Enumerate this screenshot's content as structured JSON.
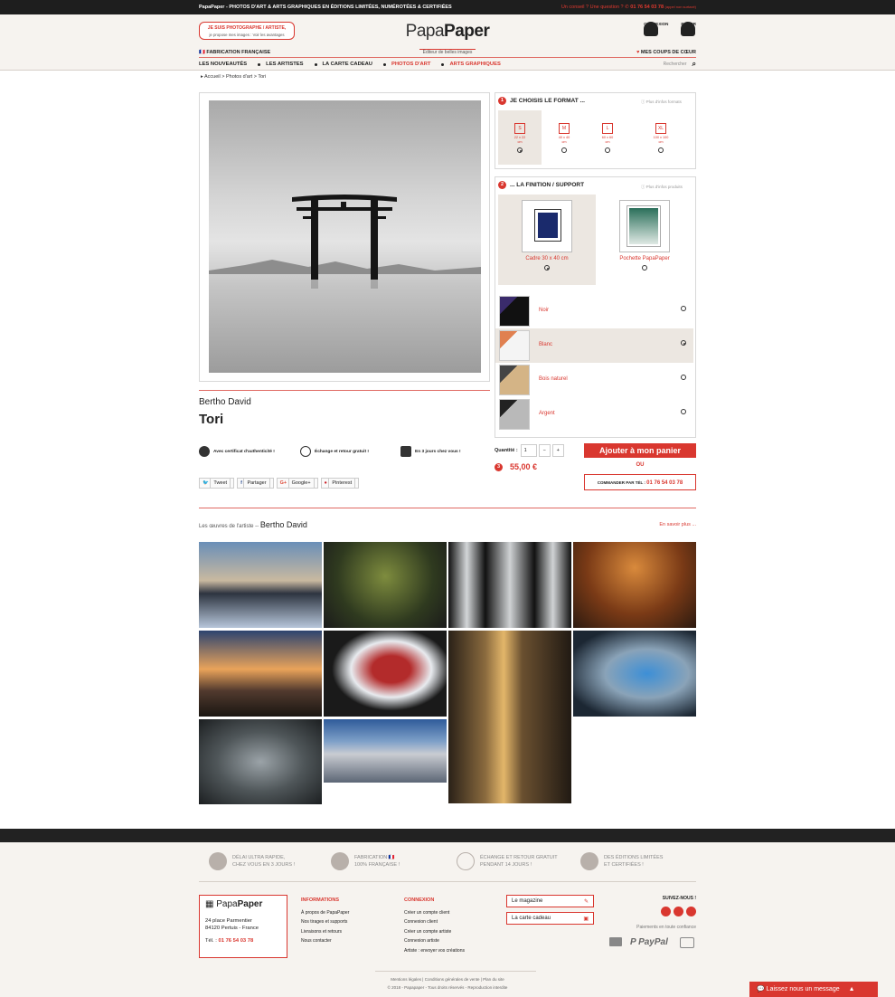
{
  "topbar": {
    "brand_small": "PapaPaper",
    "tagline": "- PHOTOS D'ART & ARTS GRAPHIQUES EN ÉDITIONS LIMITÉES, NUMÉROTÉES & CERTIFIÉES",
    "conseil": "Un conseil ? Une question ?",
    "phone": "01 76 54 03 78",
    "phone_note": "(appel non surtaxé)"
  },
  "header": {
    "photographer_btn": "JE SUIS PHOTOGRAPHE / ARTISTE,",
    "photographer_sub": "je propose mes images : Voir les avantages",
    "logo_light": "Papa",
    "logo_bold": "Paper",
    "logo_sub": "Éditeur de belles images",
    "connexion": "CONNEXION",
    "panier": "PANIER",
    "fabrication": "FABRICATION FRANÇAISE",
    "coups_coeur": "MES COUPS DE CŒUR",
    "search_placeholder": "Rechercher"
  },
  "nav": [
    "LES NOUVEAUTÉS",
    "LES ARTISTES",
    "LA CARTE CADEAU",
    "PHOTOS D'ART",
    "ARTS GRAPHIQUES"
  ],
  "breadcrumb": "Accueil > Photos d'art > Tori",
  "product": {
    "artist": "Bertho David",
    "title": "Tori",
    "features": [
      "Avec certificat d'authenticité !",
      "Échange et retour gratuit !",
      "En 3 jours chez vous !"
    ],
    "share": [
      "Tweet",
      "Partager",
      "Google+",
      "Pinterest"
    ]
  },
  "step1": {
    "num": "1",
    "title": "JE CHOISIS LE FORMAT ...",
    "info": "Plus d'infos formats",
    "formats": [
      {
        "size": "S",
        "dim": "22 x 22",
        "unit": "cm",
        "selected": true
      },
      {
        "size": "M",
        "dim": "40 x 40",
        "unit": "cm",
        "selected": false
      },
      {
        "size": "L",
        "dim": "60 x 60",
        "unit": "cm",
        "selected": false
      },
      {
        "size": "XL",
        "dim": "100 x 100",
        "unit": "cm",
        "selected": false
      }
    ]
  },
  "step2": {
    "num": "2",
    "title": "... LA FINITION / SUPPORT",
    "info": "Plus d'infos produits",
    "finishes": [
      {
        "label": "Cadre 30 x 40 cm",
        "selected": true
      },
      {
        "label": "Pochette PapaPaper",
        "selected": false
      }
    ],
    "frames": [
      {
        "label": "Noir",
        "selected": false
      },
      {
        "label": "Blanc",
        "selected": true
      },
      {
        "label": "Bois naturel",
        "selected": false
      },
      {
        "label": "Argent",
        "selected": false
      }
    ]
  },
  "purchase": {
    "qty_label": "Quantité :",
    "qty_value": "1",
    "minus": "−",
    "plus": "+",
    "step_num": "3",
    "price": "55,00 €",
    "add_to_cart": "Ajouter à mon panier",
    "ou": "OU",
    "phone_order": "COMMANDER PAR TÉL :",
    "phone": "01 76 54 03 78"
  },
  "artist_works": {
    "label": "Les œuvres de l'artiste --",
    "artist": "Bertho David",
    "more": "En savoir plus ..."
  },
  "footer": {
    "reassurance": [
      {
        "l1": "DÉLAI ULTRA RAPIDE,",
        "l2": "CHEZ VOUS EN 3 JOURS !"
      },
      {
        "l1": "FABRICATION 🇫🇷",
        "l2": "100% FRANÇAISE !"
      },
      {
        "l1": "ÉCHANGE ET RETOUR GRATUIT",
        "l2": "PENDANT 14 JOURS !"
      },
      {
        "l1": "DES ÉDITIONS LIMITÉES",
        "l2": "ET CERTIFIÉES !"
      }
    ],
    "address": {
      "logo_light": "Papa",
      "logo_bold": "Paper",
      "line1": "24 place Parmentier",
      "line2": "84120 Pertuis - France",
      "tel_label": "Tél. :",
      "tel": "01 76 54 03 78"
    },
    "informations": {
      "title": "INFORMATIONS",
      "links": [
        "À propos de PapaPaper",
        "Nos tirages et supports",
        "Livraisons et retours",
        "Nous contacter"
      ]
    },
    "connexion": {
      "title": "CONNEXION",
      "links": [
        "Créer un compte client",
        "Connexion client",
        "Créer un compte artiste",
        "Connexion artiste",
        "Artiste : envoyer vos créations"
      ]
    },
    "magazine": "Le magazine",
    "carte_cadeau": "La carte cadeau",
    "suivez": "SUIVEZ-NOUS !",
    "paiements": "Paiements en toute confiance",
    "paypal": "P PayPal",
    "legal_links": "Mentions légales | Conditions générales de vente | Plan du site",
    "copyright": "© 2018 - Papapaper - Tous droits réservés - Reproduction interdite"
  },
  "chat": "Laissez nous un message"
}
